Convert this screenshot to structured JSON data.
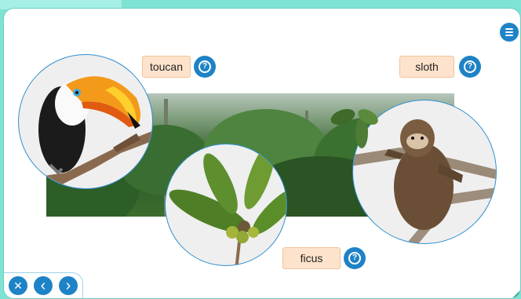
{
  "labels": {
    "toucan": "toucan",
    "sloth": "sloth",
    "ficus": "ficus"
  },
  "help_glyph": "?",
  "nav": {
    "close_glyph": "✕",
    "prev_glyph": "‹",
    "next_glyph": "›"
  },
  "colors": {
    "accent": "#1e82c6",
    "label_bg": "#fde3cc",
    "frame": "#7fe3d4"
  },
  "icons": [
    "menu-icon",
    "help-icon",
    "close-icon",
    "chevron-left-icon",
    "chevron-right-icon"
  ]
}
